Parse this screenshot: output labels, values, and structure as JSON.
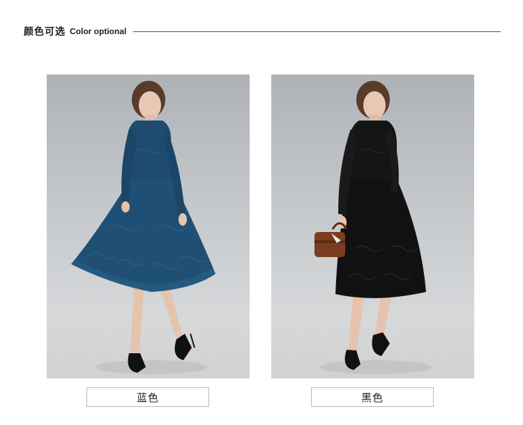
{
  "header": {
    "title_cn": "颜色可选",
    "title_en": "Color optional"
  },
  "variants": [
    {
      "label": "蓝色",
      "dress_color": "#1f4f74"
    },
    {
      "label": "黑色",
      "dress_color": "#111111"
    }
  ],
  "colors": {
    "background_gradient_top": "#aeb2b6",
    "background_gradient_bottom": "#d6d8da",
    "bag": "#7a3d1f"
  }
}
